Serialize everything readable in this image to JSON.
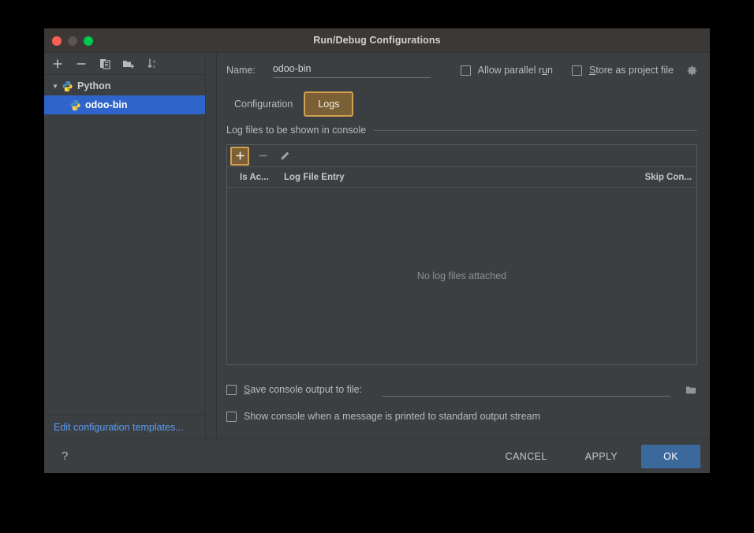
{
  "window": {
    "title": "Run/Debug Configurations",
    "traffic_lights": [
      "close-red",
      "minimize-gray",
      "maximize-green"
    ]
  },
  "sidebar": {
    "toolbar": [
      {
        "name": "add-configuration-button",
        "icon": "plus-icon",
        "label": "+"
      },
      {
        "name": "remove-configuration-button",
        "icon": "minus-icon",
        "label": "−"
      },
      {
        "name": "copy-configuration-button",
        "icon": "copy-icon",
        "label": "copy"
      },
      {
        "name": "save-configuration-button",
        "icon": "folder-add-icon",
        "label": "folder-add"
      },
      {
        "name": "sort-configurations-button",
        "icon": "sort-az-icon",
        "label": "sort"
      }
    ],
    "tree": [
      {
        "label": "Python",
        "type": "group",
        "expanded": true,
        "icon": "python-icon"
      },
      {
        "label": "odoo-bin",
        "type": "item",
        "selected": true,
        "icon": "python-icon"
      }
    ],
    "footer_link": "Edit configuration templates..."
  },
  "main": {
    "name_label": "Name:",
    "name_value": "odoo-bin",
    "allow_parallel_run": {
      "label": "Allow parallel run",
      "checked": false
    },
    "store_as_project_file": {
      "label": "Store as project file",
      "checked": false
    },
    "gear_icon": "gear-icon",
    "tabs": [
      {
        "label": "Configuration",
        "active": false,
        "highlighted": false
      },
      {
        "label": "Logs",
        "active": true,
        "highlighted": true
      }
    ],
    "logs_panel": {
      "group_title": "Log files to be shown in console",
      "toolbar": [
        {
          "name": "add-log-file-button",
          "icon": "plus-icon",
          "label": "+",
          "highlighted": true
        },
        {
          "name": "remove-log-file-button",
          "icon": "minus-icon",
          "label": "−",
          "highlighted": false
        },
        {
          "name": "edit-log-file-button",
          "icon": "pencil-icon",
          "label": "edit",
          "highlighted": false
        }
      ],
      "columns": [
        "Is Ac...",
        "Log File Entry",
        "Skip Con..."
      ],
      "empty_text": "No log files attached",
      "rows": []
    },
    "save_console_output": {
      "label": "Save console output to file:",
      "checked": false,
      "value": "",
      "browse_icon": "folder-icon"
    },
    "show_console_on_stdout": {
      "label": "Show console when a message is printed to standard output stream",
      "checked": false
    }
  },
  "footer": {
    "help_label": "?",
    "cancel_label": "CANCEL",
    "apply_label": "APPLY",
    "ok_label": "OK"
  },
  "colors": {
    "window_bg": "#3c3f41",
    "titlebar_bg": "#3c3836",
    "selection_blue": "#2f65ca",
    "primary_button": "#3c699c",
    "highlight_border": "#d2a051",
    "highlight_fill": "#7a6034",
    "link_blue": "#589df6"
  }
}
